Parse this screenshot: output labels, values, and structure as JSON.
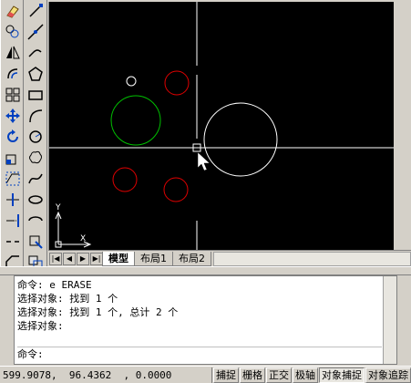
{
  "layout_tabs": [
    {
      "label": "模型",
      "active": true
    },
    {
      "label": "布局1",
      "active": false
    },
    {
      "label": "布局2",
      "active": false
    }
  ],
  "ucs": {
    "x_label": "X",
    "y_label": "Y"
  },
  "command": {
    "history": [
      "命令: e ERASE",
      "选择对象: 找到 1 个",
      "选择对象: 找到 1 个, 总计 2 个",
      "选择对象:"
    ],
    "prompt": "命令:"
  },
  "status": {
    "coords": "599.9078,  96.4362  , 0.0000",
    "toggles": [
      {
        "label": "捕捉",
        "on": false
      },
      {
        "label": "栅格",
        "on": false
      },
      {
        "label": "正交",
        "on": false
      },
      {
        "label": "极轴",
        "on": false
      },
      {
        "label": "对象捕捉",
        "on": true
      },
      {
        "label": "对象追踪",
        "on": false
      }
    ]
  },
  "colors": {
    "canvas": "#000000",
    "white_entity": "#ffffff",
    "green_entity": "#00c000",
    "red_entity": "#e00000"
  },
  "tools_left": [
    "eraser-icon",
    "copy-icon",
    "mirror-icon",
    "offset-icon",
    "array-icon",
    "move-icon",
    "rotate-icon",
    "scale-icon",
    "stretch-icon",
    "trim-icon",
    "extend-icon",
    "break-icon",
    "chamfer-icon"
  ],
  "tools_draw": [
    "line-icon",
    "construction-line-icon",
    "polyline-icon",
    "polygon-icon",
    "rectangle-icon",
    "arc-icon",
    "circle-icon",
    "revision-cloud-icon",
    "spline-icon",
    "ellipse-icon",
    "ellipse-arc-icon",
    "insert-block-icon",
    "make-block-icon"
  ]
}
